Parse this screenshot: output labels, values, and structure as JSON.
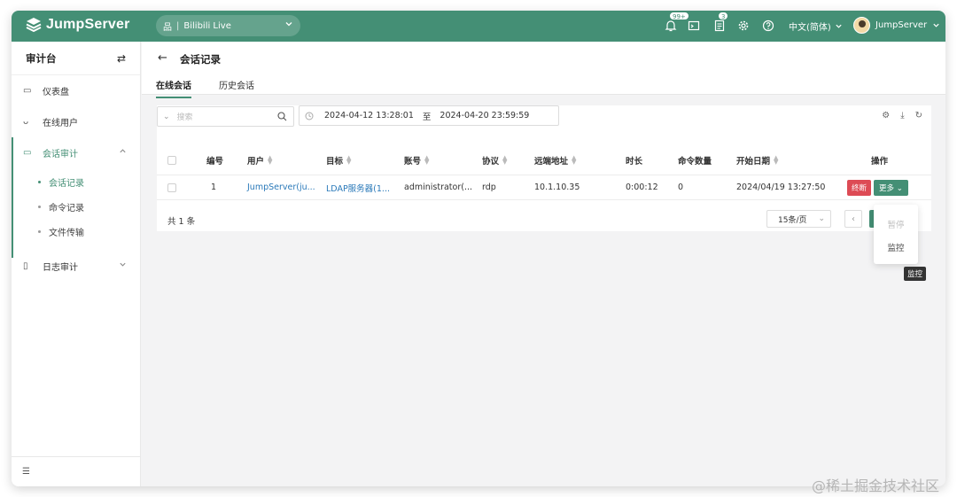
{
  "app": {
    "name": "JumpServer"
  },
  "org": {
    "label": "Bilibili Live"
  },
  "topbar": {
    "notify_badge": "99+",
    "tickets_badge": "3",
    "language": "中文(简体)",
    "username": "JumpServer"
  },
  "sidebar": {
    "title": "审计台",
    "items": [
      {
        "label": "仪表盘"
      },
      {
        "label": "在线用户"
      },
      {
        "label": "会话审计"
      },
      {
        "label": "日志审计"
      }
    ],
    "subitems": [
      {
        "label": "会话记录"
      },
      {
        "label": "命令记录"
      },
      {
        "label": "文件传输"
      }
    ]
  },
  "page": {
    "title": "会话记录",
    "tabs": [
      {
        "label": "在线会话"
      },
      {
        "label": "历史会话"
      }
    ]
  },
  "filters": {
    "search_placeholder": "搜索",
    "date_start": "2024-04-12 13:28:01",
    "date_sep": "至",
    "date_end": "2024-04-20 23:59:59"
  },
  "table": {
    "headers": {
      "id": "编号",
      "user": "用户",
      "target": "目标",
      "account": "账号",
      "protocol": "协议",
      "remote_addr": "远端地址",
      "duration": "时长",
      "commands": "命令数量",
      "start_date": "开始日期",
      "actions": "操作"
    },
    "rows": [
      {
        "id": "1",
        "user": "JumpServer(ju...",
        "target": "LDAP服务器(1...",
        "account": "administrator(...",
        "protocol": "rdp",
        "remote_addr": "10.1.10.35",
        "duration": "0:00:12",
        "commands": "0",
        "start_date": "2024/04/19 13:27:50",
        "terminate_label": "终断",
        "more_label": "更多"
      }
    ],
    "total": "共 1 条",
    "page_size": "15条/页"
  },
  "dropdown": {
    "items": [
      {
        "label": "暂停"
      },
      {
        "label": "监控"
      }
    ]
  },
  "tooltip": "监控",
  "watermark": "@稀土掘金技术社区",
  "colors": {
    "brand": "#448f75",
    "danger": "#dd4b55",
    "link": "#2a79b9"
  }
}
